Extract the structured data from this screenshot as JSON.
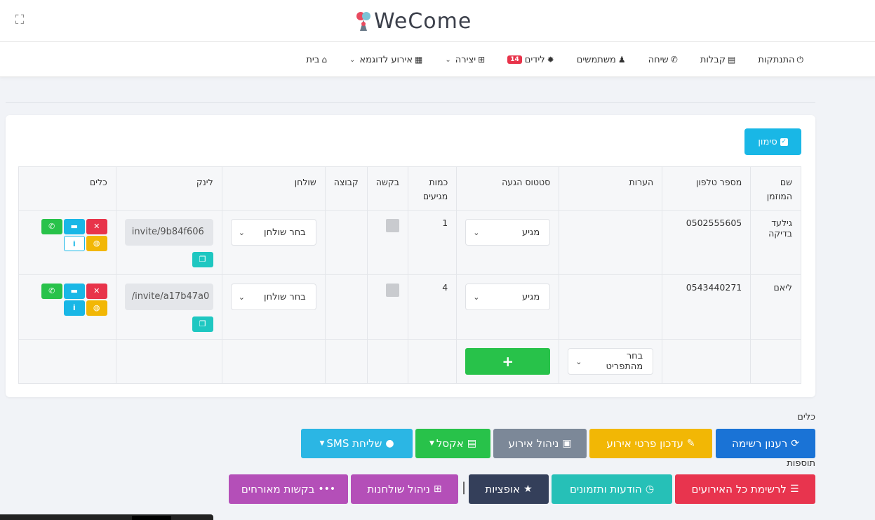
{
  "header": {
    "logo_text": "WeCome"
  },
  "nav": {
    "items": [
      {
        "label": "בית",
        "icon": "home-icon",
        "glyph": "⌂"
      },
      {
        "label": "אירוע לדוגמא",
        "icon": "calendar-icon",
        "glyph": "▦",
        "caret": true
      },
      {
        "label": "יצירה",
        "icon": "plus-square-icon",
        "glyph": "⊞",
        "caret": true
      },
      {
        "label": "לידים",
        "icon": "gear-icon",
        "glyph": "✹",
        "badge": "14"
      },
      {
        "label": "משתמשים",
        "icon": "users-icon",
        "glyph": "♟"
      },
      {
        "label": "שיחה",
        "icon": "phone-icon",
        "glyph": "✆"
      },
      {
        "label": "קבלות",
        "icon": "receipt-icon",
        "glyph": "▤"
      },
      {
        "label": "התנתקות",
        "icon": "power-icon",
        "glyph": "⏻"
      }
    ]
  },
  "mark_button": {
    "label": "סימון"
  },
  "table": {
    "headers": [
      "שם המוזמן",
      "מספר טלפון",
      "הערות",
      "סטטוס הגעה",
      "כמות מגיעים",
      "בקשה",
      "קבוצה",
      "שולחן",
      "לינק",
      "כלים"
    ],
    "rows": [
      {
        "name": "גילעד בדיקה",
        "phone": "0502555605",
        "notes": "",
        "status": "מגיע",
        "count": "1",
        "table": "בחר שולחן",
        "link": "invite/9b84f606"
      },
      {
        "name": "ליאם",
        "phone": "0543440271",
        "notes": "",
        "status": "מגיע",
        "count": "4",
        "table": "בחר שולחן",
        "link": "/invite/a17b47a0"
      }
    ],
    "footer_select": "בחר מהתפריט",
    "add_label": "+"
  },
  "sections": {
    "tools_label": "כלים",
    "extras_label": "תוספות"
  },
  "tool_buttons": [
    {
      "label": "רענון רשימה",
      "color": "#1a73d6",
      "icon": "refresh-icon"
    },
    {
      "label": "עדכון פרטי אירוע",
      "color": "#f2b705",
      "icon": "edit-icon"
    },
    {
      "label": "ניהול אירוע",
      "color": "#7c8898",
      "icon": "briefcase-icon"
    },
    {
      "label": "אקסל",
      "color": "#28c24a",
      "icon": "excel-icon"
    },
    {
      "label": "שליחת SMS",
      "color": "#2bb6e4",
      "icon": "comment-icon"
    }
  ],
  "extra_buttons": [
    {
      "label": "לרשימת כל האירועים",
      "color": "#e8344e",
      "icon": "list-icon"
    },
    {
      "label": "הודעות ותזמונים",
      "color": "#26c0b7",
      "icon": "clock-icon"
    },
    {
      "label": "אופציות",
      "color": "#343f5a",
      "icon": "star-icon"
    },
    {
      "label": "ניהול שולחנות",
      "color": "#b44fb8",
      "icon": "table-icon"
    },
    {
      "label": "בקשות מאורחים",
      "color": "#b44fb8",
      "icon": "dots-icon"
    }
  ],
  "colors": {
    "accent_blue": "#19b7e6",
    "danger": "#e8334a",
    "success": "#28c24a",
    "warning": "#f2b705",
    "teal": "#1ec7c1"
  }
}
